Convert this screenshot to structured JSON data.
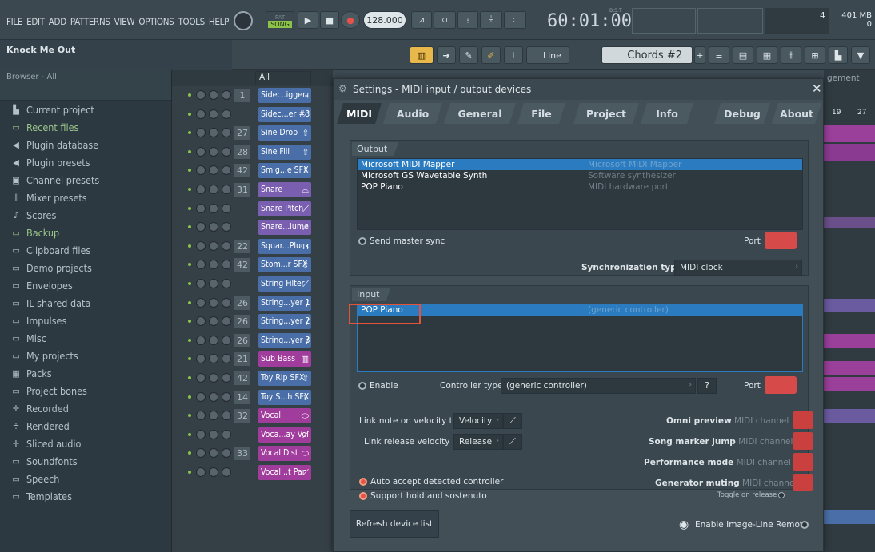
{
  "menu": [
    "FILE",
    "EDIT",
    "ADD",
    "PATTERNS",
    "VIEW",
    "OPTIONS",
    "TOOLS",
    "HELP"
  ],
  "transport": {
    "mode": "SONG",
    "pat_label": "PAT",
    "tempo": "128.000",
    "time": "60:01:00",
    "time_small": "B:S:T",
    "snap": "Line",
    "preset": "Chords #2"
  },
  "cpu": {
    "value": "4",
    "memory": "401 MB",
    "extra": "0"
  },
  "hint": {
    "title": "Knock Me Out"
  },
  "browser": {
    "header": "Browser - All",
    "items": [
      {
        "label": "Current project",
        "icon": "project-icon",
        "glyph": "▙",
        "green": false
      },
      {
        "label": "Recent files",
        "icon": "folder-icon",
        "glyph": "▭",
        "green": true
      },
      {
        "label": "Plugin database",
        "icon": "plugin-icon",
        "glyph": "◀",
        "green": false
      },
      {
        "label": "Plugin presets",
        "icon": "plugin-icon",
        "glyph": "◀",
        "green": false
      },
      {
        "label": "Channel presets",
        "icon": "channel-icon",
        "glyph": "▣",
        "green": false
      },
      {
        "label": "Mixer presets",
        "icon": "mixer-icon",
        "glyph": "⫲",
        "green": false
      },
      {
        "label": "Scores",
        "icon": "note-icon",
        "glyph": "♪",
        "green": false
      },
      {
        "label": "Backup",
        "icon": "folder-icon",
        "glyph": "▭",
        "green": true
      },
      {
        "label": "Clipboard files",
        "icon": "folder-icon",
        "glyph": "▭",
        "green": false
      },
      {
        "label": "Demo projects",
        "icon": "folder-icon",
        "glyph": "▭",
        "green": false
      },
      {
        "label": "Envelopes",
        "icon": "folder-icon",
        "glyph": "▭",
        "green": false
      },
      {
        "label": "IL shared data",
        "icon": "folder-icon",
        "glyph": "▭",
        "green": false
      },
      {
        "label": "Impulses",
        "icon": "folder-icon",
        "glyph": "▭",
        "green": false
      },
      {
        "label": "Misc",
        "icon": "folder-icon",
        "glyph": "▭",
        "green": false
      },
      {
        "label": "My projects",
        "icon": "folder-icon",
        "glyph": "▭",
        "green": false
      },
      {
        "label": "Packs",
        "icon": "packs-icon",
        "glyph": "▦",
        "green": false
      },
      {
        "label": "Project bones",
        "icon": "folder-icon",
        "glyph": "▭",
        "green": false
      },
      {
        "label": "Recorded",
        "icon": "recorded-icon",
        "glyph": "✛",
        "green": false
      },
      {
        "label": "Rendered",
        "icon": "rendered-icon",
        "glyph": "≑",
        "green": false
      },
      {
        "label": "Sliced audio",
        "icon": "sliced-icon",
        "glyph": "✛",
        "green": false
      },
      {
        "label": "Soundfonts",
        "icon": "folder-icon",
        "glyph": "▭",
        "green": false
      },
      {
        "label": "Speech",
        "icon": "folder-icon",
        "glyph": "▭",
        "green": false
      },
      {
        "label": "Templates",
        "icon": "folder-icon",
        "glyph": "▭",
        "green": false
      }
    ]
  },
  "rack": {
    "filter": "All",
    "channels": [
      {
        "num": "1",
        "name": "Sidec..igger",
        "color": "#4a6fa8",
        "ico": "⫞"
      },
      {
        "num": "",
        "name": "Sidec...er #3",
        "color": "#4a6fa8",
        "ico": "⟋"
      },
      {
        "num": "27",
        "name": "Sine Drop",
        "color": "#4a6fa8",
        "ico": "⇧"
      },
      {
        "num": "28",
        "name": "Sine Fill",
        "color": "#4a6fa8",
        "ico": "⇧"
      },
      {
        "num": "42",
        "name": "Smig...e SFX",
        "color": "#4a6fa8",
        "ico": "⇧"
      },
      {
        "num": "31",
        "name": "Snare",
        "color": "#7a5fb0",
        "ico": "⌓"
      },
      {
        "num": "",
        "name": "Snare Pitch",
        "color": "#7a5fb0",
        "ico": "⟋"
      },
      {
        "num": "",
        "name": "Snare...lume",
        "color": "#7a5fb0",
        "ico": "⟋"
      },
      {
        "num": "22",
        "name": "Squar...Pluck",
        "color": "#4a6fa8",
        "ico": "⊓"
      },
      {
        "num": "42",
        "name": "Stom...r SFX",
        "color": "#4a6fa8",
        "ico": "⇧"
      },
      {
        "num": "",
        "name": "String Filter",
        "color": "#4a6fa8",
        "ico": "⟋"
      },
      {
        "num": "26",
        "name": "String...yer 1",
        "color": "#4a6fa8",
        "ico": "∕"
      },
      {
        "num": "26",
        "name": "String...yer 2",
        "color": "#4a6fa8",
        "ico": "∕"
      },
      {
        "num": "26",
        "name": "String...yer 3",
        "color": "#4a6fa8",
        "ico": "∕"
      },
      {
        "num": "21",
        "name": "Sub Bass",
        "color": "#a03c9c",
        "ico": "▥"
      },
      {
        "num": "42",
        "name": "Toy Rip SFX",
        "color": "#4a6fa8",
        "ico": "⇧"
      },
      {
        "num": "14",
        "name": "Toy S...h SFX",
        "color": "#4a6fa8",
        "ico": "⇧"
      },
      {
        "num": "32",
        "name": "Vocal",
        "color": "#a03c9c",
        "ico": "⬭"
      },
      {
        "num": "",
        "name": "Voca...ay Vol",
        "color": "#a03c9c",
        "ico": "⟋"
      },
      {
        "num": "33",
        "name": "Vocal Dist",
        "color": "#a03c9c",
        "ico": "⬭"
      },
      {
        "num": "",
        "name": "Vocal...t Pan",
        "color": "#a03c9c",
        "ico": "⟋"
      }
    ]
  },
  "playlist": {
    "header": "gement",
    "bars": [
      "19",
      "27"
    ]
  },
  "dialog": {
    "title": "Settings - MIDI input / output devices",
    "tabs": [
      "MIDI",
      "Audio",
      "General",
      "File",
      "Project",
      "Info",
      "Debug",
      "About"
    ],
    "output": {
      "label": "Output",
      "devices": [
        {
          "name": "Microsoft MIDI Mapper",
          "desc": "Microsoft MIDI Mapper",
          "selected": true
        },
        {
          "name": "Microsoft GS Wavetable Synth",
          "desc": "Software synthesizer",
          "selected": false
        },
        {
          "name": "POP Piano",
          "desc": "MIDI hardware port",
          "selected": false
        }
      ],
      "send_master_sync": "Send master sync",
      "port_label": "Port",
      "sync_type_label": "Synchronization type",
      "sync_type_value": "MIDI clock"
    },
    "input": {
      "label": "Input",
      "devices": [
        {
          "name": "POP Piano",
          "desc": "(generic controller)",
          "selected": true
        }
      ],
      "enable_label": "Enable",
      "controller_type_label": "Controller type",
      "controller_type_value": "(generic controller)",
      "help": "?",
      "port_label": "Port"
    },
    "link_note_label": "Link note on velocity to",
    "link_note_value": "Velocity",
    "link_release_label": "Link release velocity to",
    "link_release_value": "Release",
    "omni_label": "Omni preview",
    "song_marker_label": "Song marker jump",
    "performance_label": "Performance mode",
    "generator_muting_label": "Generator muting",
    "midi_channel": "MIDI channel",
    "toggle_on_release": "Toggle on release",
    "auto_accept": "Auto accept detected controller",
    "support_hold": "Support hold and sostenuto",
    "refresh": "Refresh device list",
    "enable_remote": "Enable Image-Line Remote"
  }
}
